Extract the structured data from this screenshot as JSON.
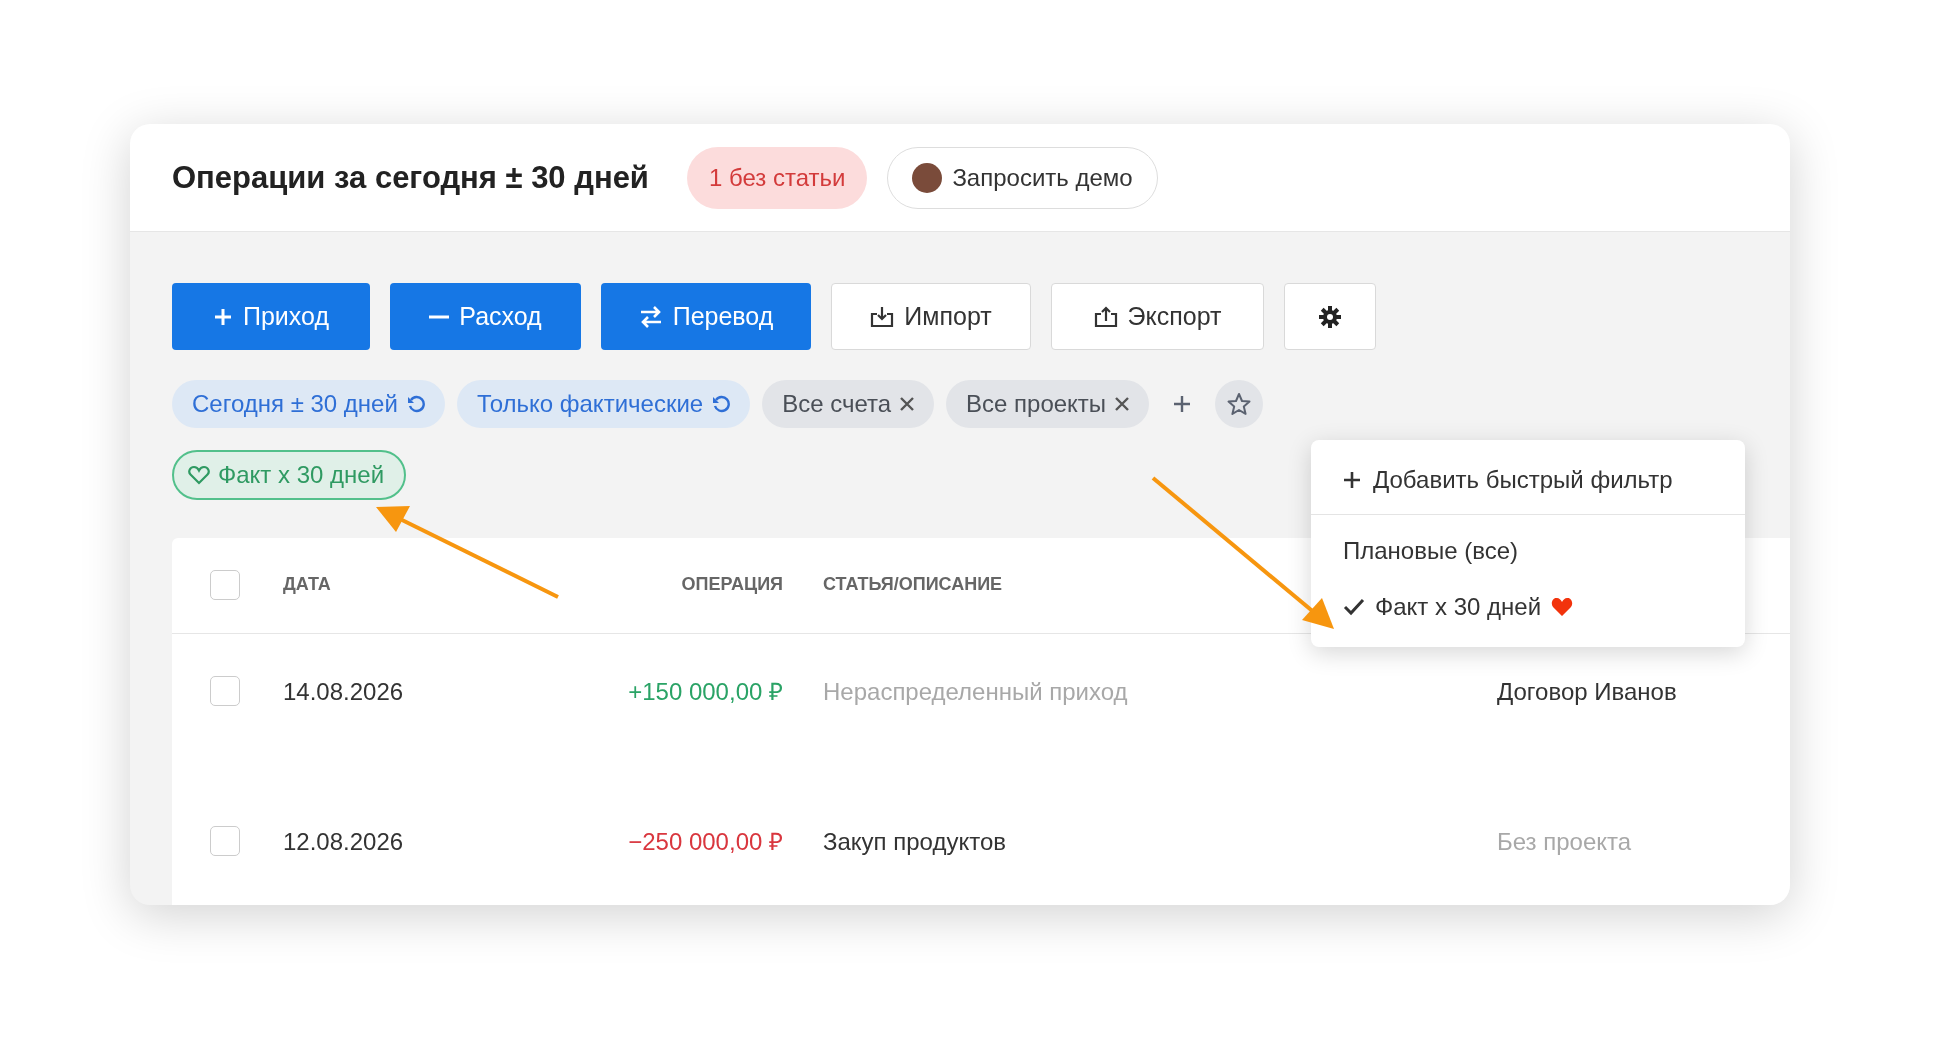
{
  "header": {
    "title": "Операции за сегодня ± 30 дней",
    "badge": {
      "label": "1 без статьи"
    },
    "demo_button": {
      "label": "Запросить демо"
    }
  },
  "toolbar": {
    "buttons": [
      {
        "label": "Приход",
        "kind": "income"
      },
      {
        "label": "Расход",
        "kind": "expense"
      },
      {
        "label": "Перевод",
        "kind": "transfer"
      },
      {
        "label": "Импорт",
        "kind": "import"
      },
      {
        "label": "Экспорт",
        "kind": "export"
      },
      {
        "kind": "settings"
      }
    ]
  },
  "filters": [
    {
      "label": "Сегодня ± 30 дней",
      "kind": "preset"
    },
    {
      "label": "Только фактические",
      "kind": "preset"
    },
    {
      "label": "Все счета",
      "kind": "removable"
    },
    {
      "label": "Все проекты",
      "kind": "removable"
    }
  ],
  "saved_filters": [
    {
      "label": "Факт х 30 дней"
    }
  ],
  "table": {
    "select_all": {
      "checked": false
    },
    "columns": [
      "ДАТА",
      "ОПЕРАЦИЯ",
      "СТАТЬЯ/ОПИСАНИЕ"
    ],
    "rows": [
      {
        "checked": false,
        "date": "14.08.2026",
        "amount": {
          "text": "+150 000,00 ₽",
          "color": "#2aa366"
        },
        "description": "Нераспределенный приход",
        "description_muted": true,
        "project": "Договор Иванов",
        "project_muted": false
      },
      {
        "checked": false,
        "date": "12.08.2026",
        "amount": {
          "text": "−250 000,00 ₽",
          "color": "#d9363e"
        },
        "description": "Закуп продуктов",
        "description_muted": false,
        "project": "Без проекта",
        "project_muted": true
      }
    ]
  },
  "quick_filter_menu": {
    "items": [
      {
        "kind": "add",
        "label": "Добавить быстрый фильтр"
      },
      {
        "kind": "option",
        "label": "Плановые (все)",
        "selected": false,
        "favorite": false
      },
      {
        "kind": "option",
        "label": "Факт х 30 дней",
        "selected": true,
        "favorite": true
      }
    ]
  }
}
